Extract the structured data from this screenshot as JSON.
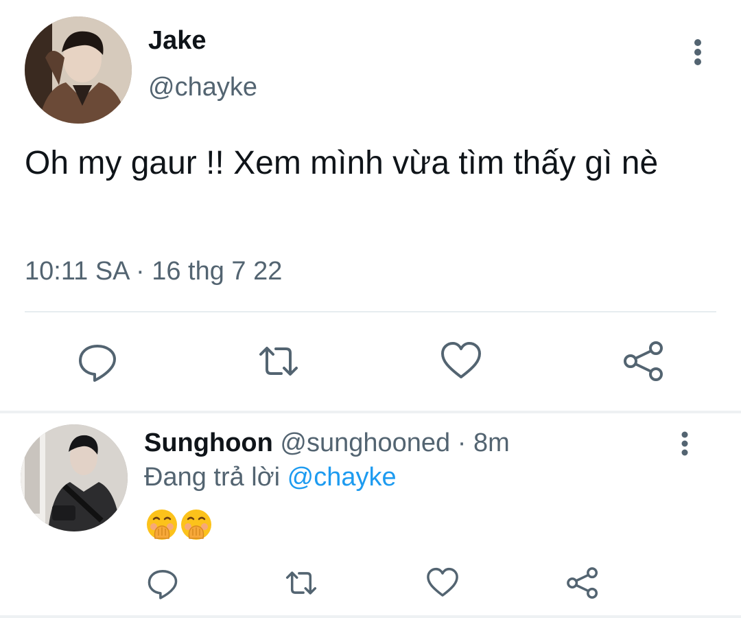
{
  "main_tweet": {
    "display_name": "Jake",
    "handle": "@chayke",
    "text": "Oh my gaur !! Xem mình vừa tìm thấy gì nè",
    "time": "10:11 SA",
    "separator": " · ",
    "date": "16 thg 7 22",
    "actions": {
      "reply_icon": "speech-bubble",
      "retweet_icon": "retweet-arrows",
      "like_icon": "heart",
      "share_icon": "share-nodes"
    }
  },
  "reply_tweet": {
    "display_name": "Sunghoon",
    "handle": "@sunghooned",
    "separator": " · ",
    "time_ago": "8m",
    "replying_prefix": "Đang trả lời ",
    "replying_to": "@chayke",
    "emojis": [
      "🤭",
      "🤭"
    ]
  },
  "colors": {
    "text_primary": "#0f1419",
    "text_secondary": "#536471",
    "link": "#1d9bf0",
    "icon": "#536471",
    "divider": "#e6ecf0"
  }
}
